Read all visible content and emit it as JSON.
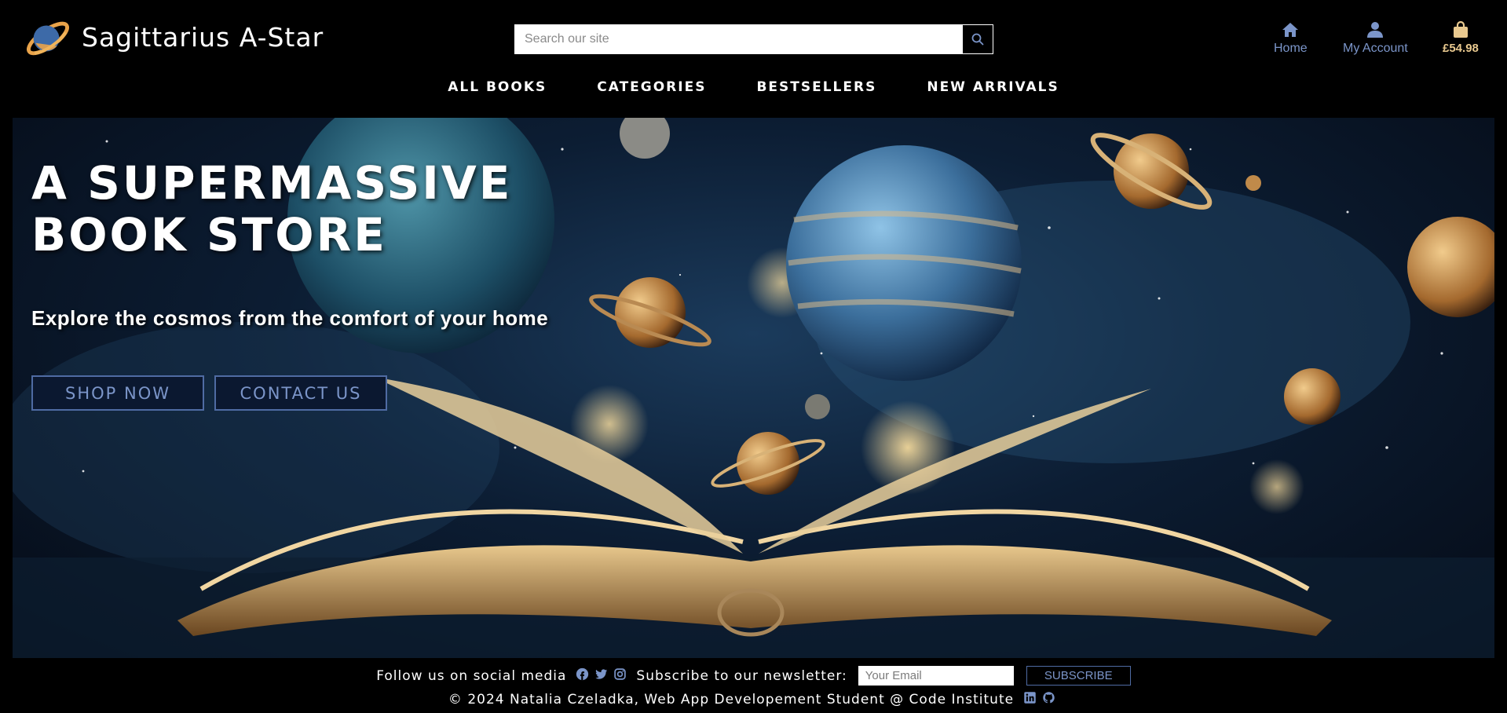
{
  "brand": {
    "name": "Sagittarius A-Star"
  },
  "search": {
    "placeholder": "Search our site"
  },
  "utilities": {
    "home_label": "Home",
    "account_label": "My Account",
    "bag_total": "£54.98"
  },
  "nav": {
    "items": [
      "ALL BOOKS",
      "CATEGORIES",
      "BESTSELLERS",
      "NEW ARRIVALS"
    ]
  },
  "hero": {
    "title_line1": "A SUPERMASSIVE",
    "title_line2": "BOOK STORE",
    "subtitle": "Explore the cosmos from the comfort of your home",
    "shop_button": "SHOP NOW",
    "contact_button": "CONTACT US"
  },
  "footer": {
    "follow_text": "Follow us on social media",
    "subscribe_text": "Subscribe to our newsletter:",
    "email_placeholder": "Your Email",
    "subscribe_button": "SUBSCRIBE",
    "copyright": "© 2024 Natalia Czeladka, Web App Developement Student @ Code Institute",
    "social_icons": [
      "facebook-icon",
      "twitter-icon",
      "instagram-icon"
    ],
    "dev_icons": [
      "linkedin-icon",
      "github-icon"
    ]
  },
  "colors": {
    "accent_blue": "#7b95c9",
    "accent_gold": "#e9c98f",
    "background": "#000000"
  }
}
